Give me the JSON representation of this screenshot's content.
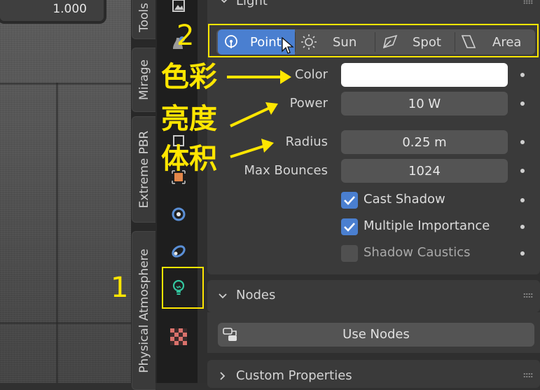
{
  "viewport": {
    "field_value": "1.000"
  },
  "side_tabs": [
    "Tools",
    "Mirage",
    "Extreme PBR",
    "Physical Atmosphere"
  ],
  "light_panel": {
    "header": "Light",
    "types": [
      {
        "label": "Point",
        "icon": "point-light-icon",
        "active": true
      },
      {
        "label": "Sun",
        "icon": "sun-icon",
        "active": false
      },
      {
        "label": "Spot",
        "icon": "spot-light-icon",
        "active": false
      },
      {
        "label": "Area",
        "icon": "area-light-icon",
        "active": false
      }
    ],
    "color_label": "Color",
    "color_value": "#ffffff",
    "power_label": "Power",
    "power_value": "10 W",
    "radius_label": "Radius",
    "radius_value": "0.25 m",
    "bounces_label": "Max Bounces",
    "bounces_value": "1024",
    "cast_shadow": {
      "label": "Cast Shadow",
      "checked": true
    },
    "multiple_importance": {
      "label": "Multiple Importance",
      "checked": true
    },
    "shadow_caustics": {
      "label": "Shadow Caustics",
      "checked": false
    }
  },
  "nodes_panel": {
    "header": "Nodes",
    "use_nodes_label": "Use Nodes"
  },
  "custom_props": {
    "header": "Custom Properties"
  },
  "annotations": {
    "num1": "1",
    "num2": "2",
    "color_cn": "色彩",
    "power_cn": "亮度",
    "radius_cn": "体积",
    "color": "#ffe600"
  }
}
